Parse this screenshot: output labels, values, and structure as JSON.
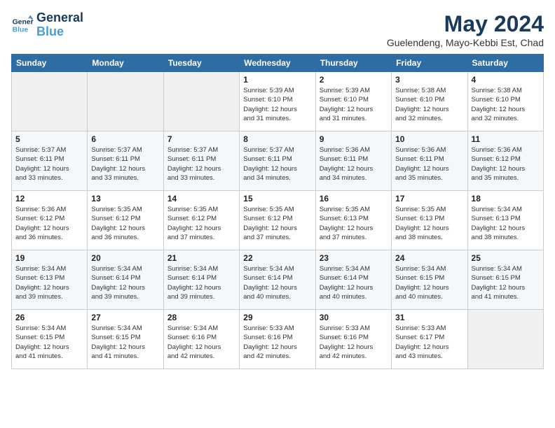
{
  "header": {
    "logo_line1": "General",
    "logo_line2": "Blue",
    "month_title": "May 2024",
    "location": "Guelendeng, Mayo-Kebbi Est, Chad"
  },
  "weekdays": [
    "Sunday",
    "Monday",
    "Tuesday",
    "Wednesday",
    "Thursday",
    "Friday",
    "Saturday"
  ],
  "weeks": [
    [
      {
        "day": "",
        "info": ""
      },
      {
        "day": "",
        "info": ""
      },
      {
        "day": "",
        "info": ""
      },
      {
        "day": "1",
        "info": "Sunrise: 5:39 AM\nSunset: 6:10 PM\nDaylight: 12 hours\nand 31 minutes."
      },
      {
        "day": "2",
        "info": "Sunrise: 5:39 AM\nSunset: 6:10 PM\nDaylight: 12 hours\nand 31 minutes."
      },
      {
        "day": "3",
        "info": "Sunrise: 5:38 AM\nSunset: 6:10 PM\nDaylight: 12 hours\nand 32 minutes."
      },
      {
        "day": "4",
        "info": "Sunrise: 5:38 AM\nSunset: 6:10 PM\nDaylight: 12 hours\nand 32 minutes."
      }
    ],
    [
      {
        "day": "5",
        "info": "Sunrise: 5:37 AM\nSunset: 6:11 PM\nDaylight: 12 hours\nand 33 minutes."
      },
      {
        "day": "6",
        "info": "Sunrise: 5:37 AM\nSunset: 6:11 PM\nDaylight: 12 hours\nand 33 minutes."
      },
      {
        "day": "7",
        "info": "Sunrise: 5:37 AM\nSunset: 6:11 PM\nDaylight: 12 hours\nand 33 minutes."
      },
      {
        "day": "8",
        "info": "Sunrise: 5:37 AM\nSunset: 6:11 PM\nDaylight: 12 hours\nand 34 minutes."
      },
      {
        "day": "9",
        "info": "Sunrise: 5:36 AM\nSunset: 6:11 PM\nDaylight: 12 hours\nand 34 minutes."
      },
      {
        "day": "10",
        "info": "Sunrise: 5:36 AM\nSunset: 6:11 PM\nDaylight: 12 hours\nand 35 minutes."
      },
      {
        "day": "11",
        "info": "Sunrise: 5:36 AM\nSunset: 6:12 PM\nDaylight: 12 hours\nand 35 minutes."
      }
    ],
    [
      {
        "day": "12",
        "info": "Sunrise: 5:36 AM\nSunset: 6:12 PM\nDaylight: 12 hours\nand 36 minutes."
      },
      {
        "day": "13",
        "info": "Sunrise: 5:35 AM\nSunset: 6:12 PM\nDaylight: 12 hours\nand 36 minutes."
      },
      {
        "day": "14",
        "info": "Sunrise: 5:35 AM\nSunset: 6:12 PM\nDaylight: 12 hours\nand 37 minutes."
      },
      {
        "day": "15",
        "info": "Sunrise: 5:35 AM\nSunset: 6:12 PM\nDaylight: 12 hours\nand 37 minutes."
      },
      {
        "day": "16",
        "info": "Sunrise: 5:35 AM\nSunset: 6:13 PM\nDaylight: 12 hours\nand 37 minutes."
      },
      {
        "day": "17",
        "info": "Sunrise: 5:35 AM\nSunset: 6:13 PM\nDaylight: 12 hours\nand 38 minutes."
      },
      {
        "day": "18",
        "info": "Sunrise: 5:34 AM\nSunset: 6:13 PM\nDaylight: 12 hours\nand 38 minutes."
      }
    ],
    [
      {
        "day": "19",
        "info": "Sunrise: 5:34 AM\nSunset: 6:13 PM\nDaylight: 12 hours\nand 39 minutes."
      },
      {
        "day": "20",
        "info": "Sunrise: 5:34 AM\nSunset: 6:14 PM\nDaylight: 12 hours\nand 39 minutes."
      },
      {
        "day": "21",
        "info": "Sunrise: 5:34 AM\nSunset: 6:14 PM\nDaylight: 12 hours\nand 39 minutes."
      },
      {
        "day": "22",
        "info": "Sunrise: 5:34 AM\nSunset: 6:14 PM\nDaylight: 12 hours\nand 40 minutes."
      },
      {
        "day": "23",
        "info": "Sunrise: 5:34 AM\nSunset: 6:14 PM\nDaylight: 12 hours\nand 40 minutes."
      },
      {
        "day": "24",
        "info": "Sunrise: 5:34 AM\nSunset: 6:15 PM\nDaylight: 12 hours\nand 40 minutes."
      },
      {
        "day": "25",
        "info": "Sunrise: 5:34 AM\nSunset: 6:15 PM\nDaylight: 12 hours\nand 41 minutes."
      }
    ],
    [
      {
        "day": "26",
        "info": "Sunrise: 5:34 AM\nSunset: 6:15 PM\nDaylight: 12 hours\nand 41 minutes."
      },
      {
        "day": "27",
        "info": "Sunrise: 5:34 AM\nSunset: 6:15 PM\nDaylight: 12 hours\nand 41 minutes."
      },
      {
        "day": "28",
        "info": "Sunrise: 5:34 AM\nSunset: 6:16 PM\nDaylight: 12 hours\nand 42 minutes."
      },
      {
        "day": "29",
        "info": "Sunrise: 5:33 AM\nSunset: 6:16 PM\nDaylight: 12 hours\nand 42 minutes."
      },
      {
        "day": "30",
        "info": "Sunrise: 5:33 AM\nSunset: 6:16 PM\nDaylight: 12 hours\nand 42 minutes."
      },
      {
        "day": "31",
        "info": "Sunrise: 5:33 AM\nSunset: 6:17 PM\nDaylight: 12 hours\nand 43 minutes."
      },
      {
        "day": "",
        "info": ""
      }
    ]
  ]
}
